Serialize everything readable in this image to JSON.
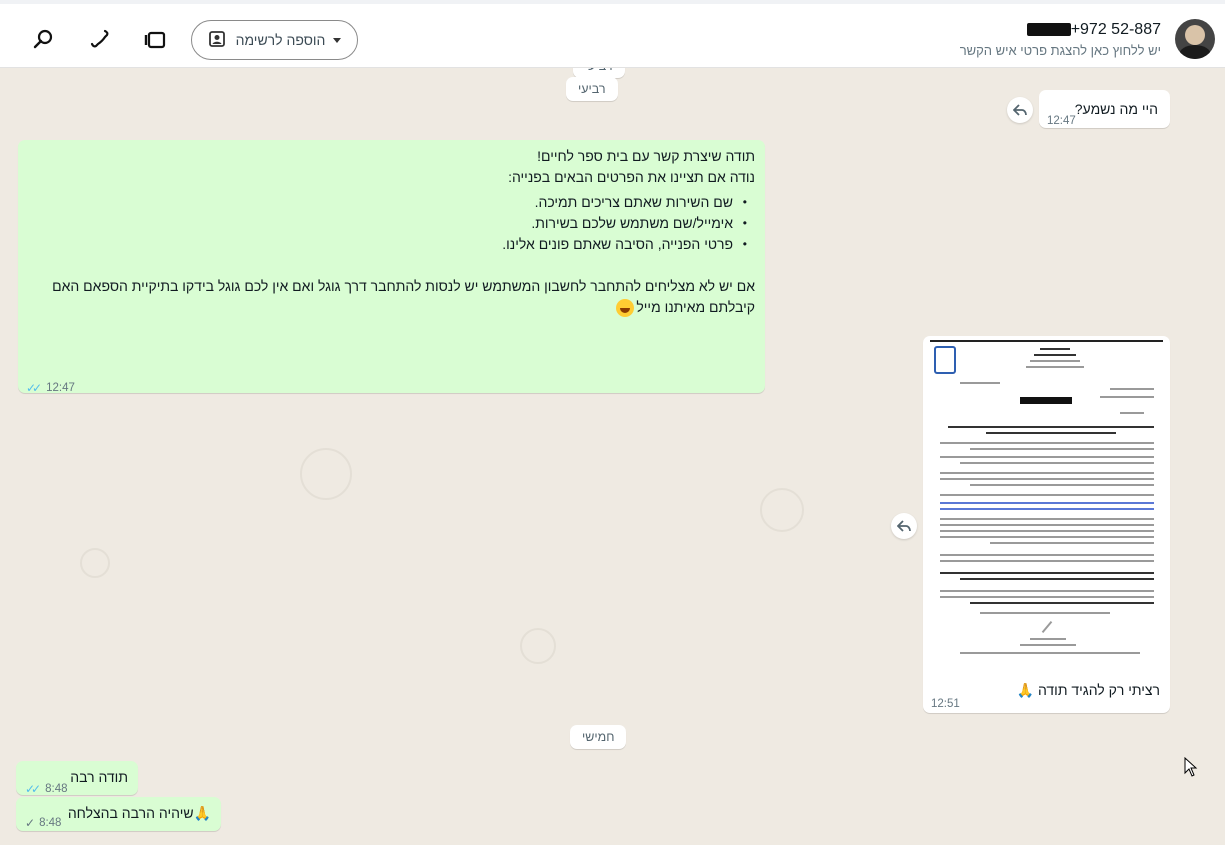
{
  "header": {
    "contact_name": "+972 52-887",
    "contact_subtitle": "יש ללחוץ כאן להצגת פרטי איש הקשר",
    "add_to_list_label": "הוספה לרשימה",
    "icons": [
      "search-icon",
      "phone-icon",
      "video-icon",
      "contacts-icon",
      "chevron-down-icon"
    ]
  },
  "chat": {
    "day_chips": [
      "רביעי",
      "רביעי",
      "חמישי"
    ],
    "messages": [
      {
        "direction": "in",
        "text": "היי מה נשמע?",
        "time": "12:47"
      },
      {
        "direction": "out",
        "lines": [
          "תודה שיצרת קשר עם בית ספר לחיים!",
          "נודה אם תציינו את הפרטים הבאים בפנייה:"
        ],
        "bullets": [
          "שם השירות שאתם צריכים תמיכה.",
          "אימייל/שם משתמש שלכם בשירות.",
          "פרטי הפנייה, הסיבה שאתם פונים אלינו."
        ],
        "footer": "אם יש לא מצליחים להתחבר לחשבון המשתמש יש לנסות להתחבר דרך גוגל ואם אין לכם גוגל בידקו בתיקיית הספאם האם קיבלתם מאיתנו מייל",
        "time": "12:47",
        "status": "read"
      },
      {
        "direction": "in",
        "type": "image",
        "caption": "רציתי רק להגיד תודה",
        "time": "12:51"
      },
      {
        "direction": "out",
        "text": "תודה רבה",
        "time": "8:48",
        "status": "read"
      },
      {
        "direction": "out",
        "text": "שיהיה הרבה בהצלחה",
        "time": "8:48",
        "status": "sent"
      }
    ]
  },
  "colors": {
    "wallpaper": "#efeae2",
    "outgoing": "#d9fdd3",
    "incoming": "#ffffff",
    "read_ticks": "#53bdeb"
  }
}
